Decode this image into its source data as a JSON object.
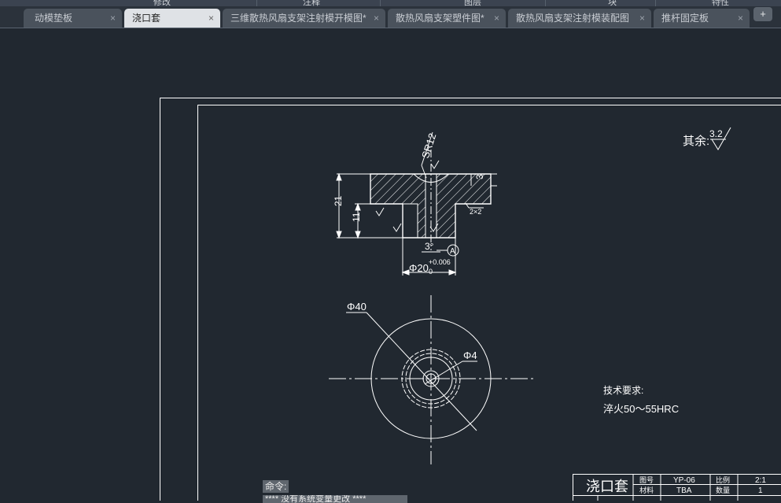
{
  "ribbon": {
    "labels": [
      "修改",
      "注释",
      "图层",
      "块",
      "特性"
    ]
  },
  "tabs": [
    {
      "label": "动模垫板",
      "active": false
    },
    {
      "label": "浇口套",
      "active": true
    },
    {
      "label": "三维散热风扇支架注射模开模图*",
      "active": false
    },
    {
      "label": "散热风扇支架塑件图*",
      "active": false
    },
    {
      "label": "散热风扇支架注射模装配图",
      "active": false
    },
    {
      "label": "推杆固定板",
      "active": false
    }
  ],
  "new_tab": "+",
  "close_icon": "×",
  "drawing": {
    "roughness_note": "其余:",
    "roughness_value": "3.2",
    "dim_sr": "SR12",
    "dim_21": "21",
    "dim_11": "11",
    "dim_3": "3",
    "dim_angle": "3°",
    "dim_phi20": "Φ20",
    "dim_tol_upper": "+0.006",
    "dim_tol_lower": "0",
    "chamfer": "2×2",
    "datum": "A",
    "dim_phi40": "Φ40",
    "dim_phi4": "Φ4",
    "tech_title": "技术要求:",
    "tech_body": "淬火50～55HRC"
  },
  "title_block": {
    "name": "浇口套",
    "drawing_no_label": "图号",
    "drawing_no": "YP-06",
    "scale_label": "比例",
    "scale": "2:1",
    "material_label": "材料",
    "material": "TBA",
    "qty_label": "数量",
    "qty": "1"
  },
  "command": {
    "prompt": "命令:",
    "history": "**** 没有系统变量更改 ****"
  },
  "colors": {
    "background": "#212830",
    "line": "#ffffff"
  }
}
